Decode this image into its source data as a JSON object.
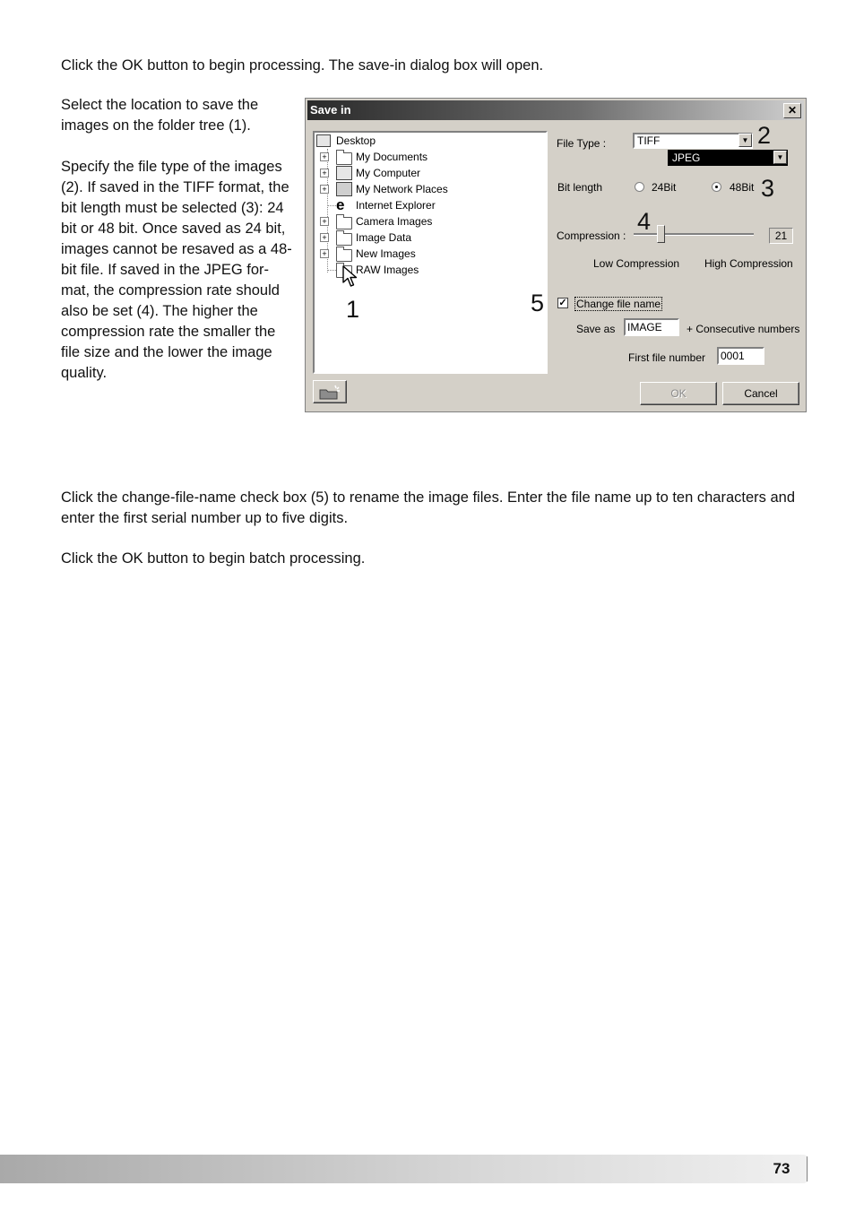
{
  "intro_text": "Click the OK button to begin processing. The save-in dialog box will open.",
  "side_paragraphs": [
    "Select the location to save the images on the folder tree (1).",
    "Specify the file type of the images (2). If saved in the TIFF format, the bit length must be selected (3): 24 bit or 48 bit. Once saved as 24 bit, images cannot be resaved as a 48-bit file. If saved in the JPEG for-mat, the compression rate should also be set (4). The higher the compression rate the smaller the file size and the lower the image quality."
  ],
  "dialog": {
    "title": "Save in",
    "close_glyph": "✕",
    "tree": [
      {
        "label": "Desktop",
        "icon": "desktop-icon"
      },
      {
        "label": "My Documents",
        "icon": "documents-folder-icon"
      },
      {
        "label": "My Computer",
        "icon": "computer-icon"
      },
      {
        "label": "My Network Places",
        "icon": "network-icon"
      },
      {
        "label": "Internet Explorer",
        "icon": "internet-explorer-icon"
      },
      {
        "label": "Camera Images",
        "icon": "folder-icon"
      },
      {
        "label": "Image Data",
        "icon": "folder-icon"
      },
      {
        "label": "New Images",
        "icon": "folder-icon"
      },
      {
        "label": "RAW Images",
        "icon": "folder-icon"
      }
    ],
    "file_type_label": "File Type :",
    "file_type_value": "TIFF",
    "file_type_dropdown_option": "JPEG",
    "bit_length_label": "Bit length",
    "bit_options": [
      {
        "label": "24Bit",
        "selected": false
      },
      {
        "label": "48Bit",
        "selected": true
      }
    ],
    "compression_label": "Compression :",
    "compression_value": "21",
    "compression_low_label": "Low Compression",
    "compression_high_label": "High Compression",
    "change_file_name_label": "Change file name",
    "change_file_name_checked": true,
    "check_glyph": "✓",
    "save_as_label": "Save as",
    "save_as_value": "IMAGE",
    "consecutive_label": "+ Consecutive numbers",
    "first_file_number_label": "First file number",
    "first_file_number_value": "0001",
    "ok_label": "OK",
    "cancel_label": "Cancel",
    "new_folder_icon": "new-folder-icon"
  },
  "callouts": {
    "one": "1",
    "two": "2",
    "three": "3",
    "four": "4",
    "five": "5"
  },
  "rename_text": "Click the change-file-name check box (5) to rename the image files. Enter the file name up to ten characters and enter the first serial number up to five digits.",
  "final_text": "Click the OK button to begin batch processing.",
  "page_number": "73",
  "colors": {
    "dialog_face": "#d4d0c8",
    "selection": "#000000"
  }
}
